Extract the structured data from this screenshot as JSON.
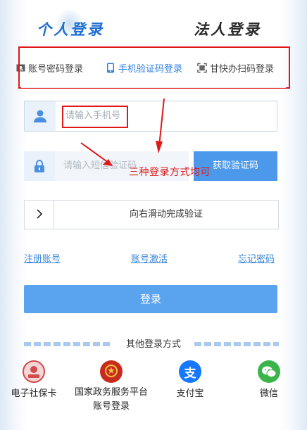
{
  "role_tabs": [
    "个人登录",
    "法人登录"
  ],
  "login_methods": [
    "账号密码登录",
    "手机验证码登录",
    "甘快办扫码登录"
  ],
  "phone_placeholder": "请输入手机号",
  "sms_placeholder": "请输入短信验证码",
  "get_code_label": "获取验证码",
  "annotation": "三种登录方式均可",
  "slider_label": "向右滑动完成验证",
  "links": [
    "注册账号",
    "账号激活",
    "忘记密码"
  ],
  "login_label": "登录",
  "other_title": "其他登录方式",
  "alt_logins": [
    "电子社保卡",
    "国家政务服务平台账号登录",
    "支付宝",
    "微信"
  ],
  "colors": {
    "accent": "#1f6fd1",
    "button": "#5aa3ee",
    "annotation": "#e01818"
  }
}
